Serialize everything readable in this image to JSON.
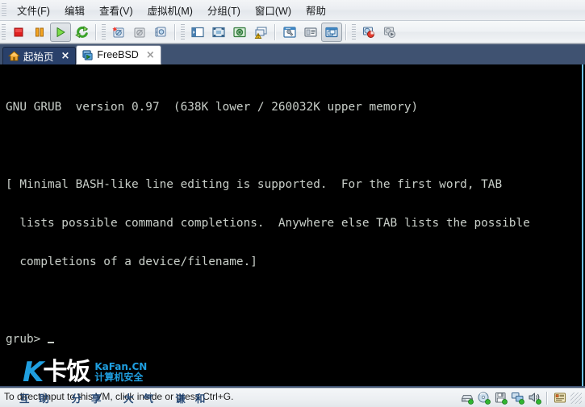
{
  "menu": {
    "items": [
      {
        "label": "文件(F)",
        "name": "menu-file"
      },
      {
        "label": "编辑",
        "name": "menu-edit"
      },
      {
        "label": "查看(V)",
        "name": "menu-view"
      },
      {
        "label": "虚拟机(M)",
        "name": "menu-vm"
      },
      {
        "label": "分组(T)",
        "name": "menu-team"
      },
      {
        "label": "窗口(W)",
        "name": "menu-window"
      },
      {
        "label": "帮助",
        "name": "menu-help"
      }
    ]
  },
  "toolbar": {
    "groups": [
      {
        "name": "power-group",
        "buttons": [
          {
            "name": "power-off-button",
            "icon": "stop-square-icon",
            "pressed": false
          },
          {
            "name": "suspend-button",
            "icon": "pause-bars-icon",
            "pressed": false
          },
          {
            "name": "power-on-button",
            "icon": "play-triangle-icon",
            "pressed": true
          },
          {
            "name": "reset-button",
            "icon": "reset-circular-arrows-icon",
            "pressed": false
          }
        ]
      },
      {
        "name": "snapshot-group",
        "buttons": [
          {
            "name": "take-snapshot-button",
            "icon": "snapshot-new-icon",
            "pressed": false
          },
          {
            "name": "revert-snapshot-button",
            "icon": "snapshot-revert-icon",
            "pressed": false
          },
          {
            "name": "snapshot-manager-button",
            "icon": "snapshot-manager-icon",
            "pressed": false
          }
        ]
      },
      {
        "name": "view-group",
        "buttons": [
          {
            "name": "show-sidebar-button",
            "icon": "sidebar-panel-icon",
            "pressed": false
          },
          {
            "name": "fullscreen-button",
            "icon": "fullscreen-corners-icon",
            "pressed": false
          },
          {
            "name": "unity-mode-button",
            "icon": "unity-mode-icon",
            "pressed": false
          },
          {
            "name": "quick-switch-button",
            "icon": "quick-switch-warning-icon",
            "pressed": false
          }
        ]
      },
      {
        "name": "settings-group",
        "buttons": [
          {
            "name": "vm-settings-button",
            "icon": "wrench-settings-icon",
            "pressed": false
          },
          {
            "name": "vm-summary-button",
            "icon": "summary-page-icon",
            "pressed": false
          },
          {
            "name": "console-view-button",
            "icon": "console-screen-icon",
            "pressed": true
          }
        ]
      },
      {
        "name": "appliance-group",
        "buttons": [
          {
            "name": "capture-screen-button",
            "icon": "capture-pie-icon",
            "pressed": false
          },
          {
            "name": "record-movie-button",
            "icon": "record-play-icon",
            "pressed": false
          }
        ]
      }
    ]
  },
  "tabs": [
    {
      "label": "起始页",
      "icon": "home-house-icon",
      "active": false,
      "close": "×",
      "name": "tab-home"
    },
    {
      "label": "FreeBSD",
      "icon": "vm-window-icon",
      "active": true,
      "close": "×",
      "name": "tab-freebsd"
    }
  ],
  "vm_console": {
    "title_line": "GNU GRUB  version 0.97  (638K lower / 260032K upper memory)",
    "help_lines": [
      "[ Minimal BASH-like line editing is supported.  For the first word, TAB",
      "  lists possible command completions.  Anywhere else TAB lists the possible",
      "  completions of a device/filename.]"
    ],
    "prompt": "grub> ",
    "foreground_color": "#c9cfc9",
    "background_color": "#000000"
  },
  "watermark": {
    "logo_mark": "K",
    "logo_cn": "卡饭",
    "site": "KaFan.CN",
    "tagline": "计算机安全"
  },
  "statusbar": {
    "message": "To direct input to this VM, click inside or press Ctrl+G.",
    "overlay_text": "互助 分享 大气 谦和",
    "icons": [
      {
        "name": "status-harddisk-icon",
        "icon": "harddisk-icon"
      },
      {
        "name": "status-cdrom-icon",
        "icon": "cdrom-disc-icon"
      },
      {
        "name": "status-floppy-icon",
        "icon": "floppy-disk-icon"
      },
      {
        "name": "status-network-icon",
        "icon": "network-adapter-icon"
      },
      {
        "name": "status-sound-icon",
        "icon": "sound-speaker-icon"
      },
      {
        "name": "status-message-log-icon",
        "icon": "message-log-icon"
      }
    ]
  },
  "colors": {
    "tabbar_bg": "#3f5271",
    "accent_blue": "#1f9fe0",
    "console_fg": "#c9cfc9",
    "console_bg": "#000000"
  }
}
